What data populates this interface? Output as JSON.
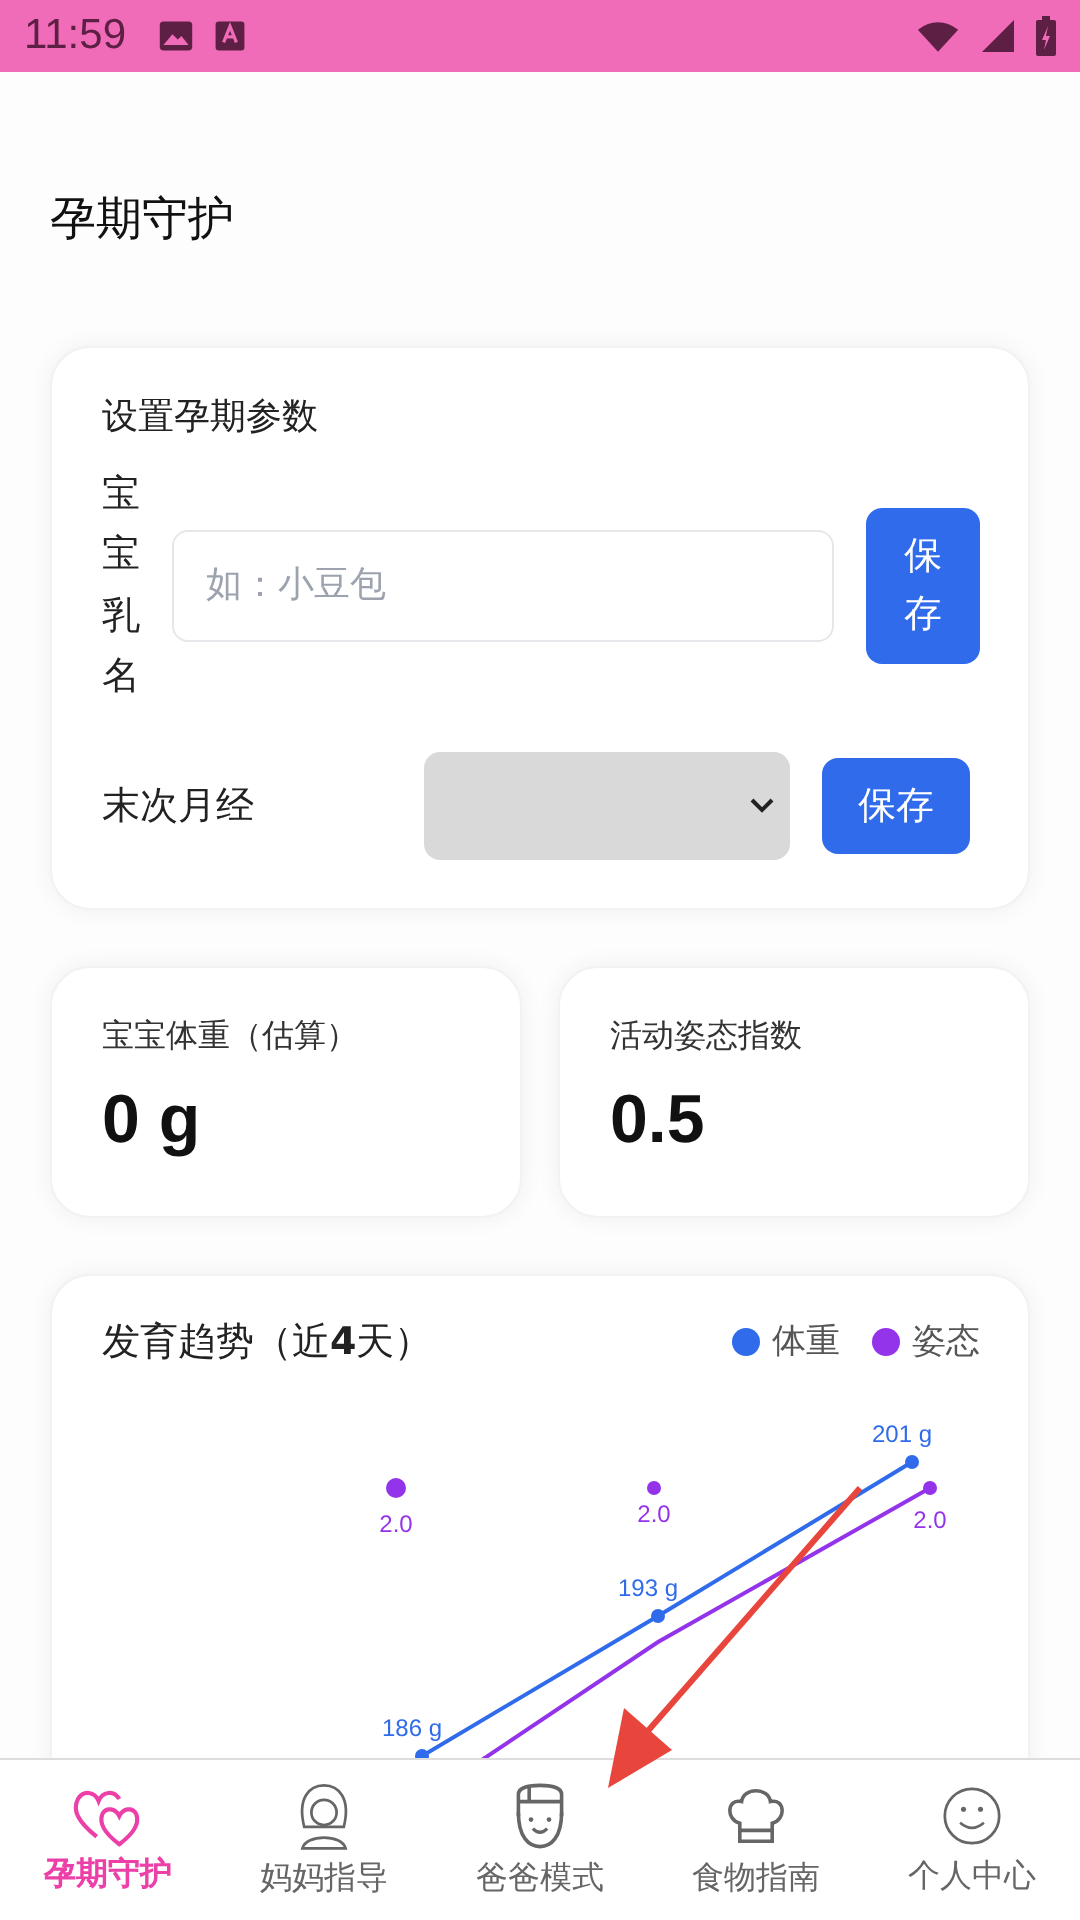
{
  "status_bar": {
    "time": "11:59"
  },
  "title": "孕期守护",
  "settings": {
    "heading": "设置孕期参数",
    "name_label": "宝宝乳名",
    "name_placeholder": "如：小豆包",
    "name_button": "保存",
    "period_label": "末次月经",
    "period_button": "保存"
  },
  "stats": [
    {
      "label": "宝宝体重（估算）",
      "value": "0 g"
    },
    {
      "label": "活动姿态指数",
      "value": "0.5"
    }
  ],
  "trend": {
    "title": "发育趋势（近**4**天）",
    "legend": [
      {
        "name": "体重",
        "color": "#2f6bea"
      },
      {
        "name": "姿态",
        "color": "#9333ea"
      }
    ],
    "weight_labels": [
      "186 g",
      "193 g",
      "201 g"
    ],
    "posture_labels": [
      "2.0",
      "2.0",
      "2.0"
    ]
  },
  "tabs": [
    {
      "label": "孕期守护",
      "selected": true
    },
    {
      "label": "妈妈指导",
      "selected": false
    },
    {
      "label": "爸爸模式",
      "selected": false
    },
    {
      "label": "食物指南",
      "selected": false
    },
    {
      "label": "个人中心",
      "selected": false
    }
  ]
}
